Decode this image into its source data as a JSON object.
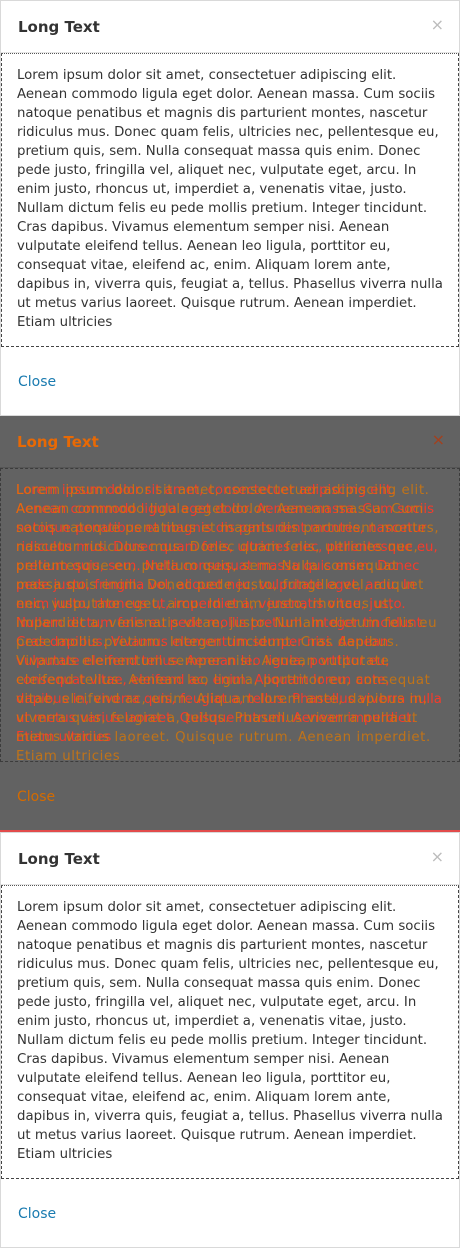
{
  "modal_top": {
    "title": "Long Text",
    "close_icon": "×",
    "body": "Lorem ipsum dolor sit amet, consectetuer adipiscing elit. Aenean commodo ligula eget dolor. Aenean massa. Cum sociis natoque penatibus et magnis dis parturient montes, nascetur ridiculus mus. Donec quam felis, ultricies nec, pellentesque eu, pretium quis, sem. Nulla consequat massa quis enim. Donec pede justo, fringilla vel, aliquet nec, vulputate eget, arcu. In enim justo, rhoncus ut, imperdiet a, venenatis vitae, justo. Nullam dictum felis eu pede mollis pretium. Integer tincidunt. Cras dapibus. Vivamus elementum semper nisi. Aenean vulputate eleifend tellus. Aenean leo ligula, porttitor eu, consequat vitae, eleifend ac, enim. Aliquam lorem ante, dapibus in, viverra quis, feugiat a, tellus. Phasellus viverra nulla ut metus varius laoreet. Quisque rutrum. Aenean imperdiet. Etiam ultricies",
    "close_label": "Close"
  },
  "modal_middle": {
    "title": "Long Text",
    "close_icon": "×",
    "body": "Lorem ipsum dolor sit amet, consectetuer adipiscing elit. Aenean commodo ligula eget dolor. Aenean massa. Cum sociis natoque penatibus et magnis dis parturient montes, nascetur ridiculus mus. Donec quam felis, ultricies nec, pellentesque eu, pretium quis, sem. Nulla consequat massa quis enim. Donec pede justo, fringilla vel, aliquet nec, vulputate eget, arcu. In enim justo, rhoncus ut, imperdiet a, venenatis vitae, justo. Nullam dictum felis eu pede mollis pretium. Integer tincidunt. Cras dapibus. Vivamus elementum semper nisi. Aenean vulputate eleifend tellus. Aenean leo ligula, porttitor eu, consequat vitae, eleifend ac, enim. Aliquam lorem ante, dapibus in, viverra quis, feugiat a, tellus. Phasellus viverra nulla ut metus varius laoreet. Quisque rutrum. Aenean imperdiet. Etiam ultricies",
    "close_label": "Close"
  },
  "modal_bottom": {
    "title": "Long Text",
    "close_icon": "×",
    "body": "Lorem ipsum dolor sit amet, consectetuer adipiscing elit. Aenean commodo ligula eget dolor. Aenean massa. Cum sociis natoque penatibus et magnis dis parturient montes, nascetur ridiculus mus. Donec quam felis, ultricies nec, pellentesque eu, pretium quis, sem. Nulla consequat massa quis enim. Donec pede justo, fringilla vel, aliquet nec, vulputate eget, arcu. In enim justo, rhoncus ut, imperdiet a, venenatis vitae, justo. Nullam dictum felis eu pede mollis pretium. Integer tincidunt. Cras dapibus. Vivamus elementum semper nisi. Aenean vulputate eleifend tellus. Aenean leo ligula, porttitor eu, consequat vitae, eleifend ac, enim. Aliquam lorem ante, dapibus in, viverra quis, feugiat a, tellus. Phasellus viverra nulla ut metus varius laoreet. Quisque rutrum. Aenean imperdiet. Etiam ultricies",
    "close_label": "Close"
  },
  "colors": {
    "overlay": "#626262",
    "link": "#1a7bb0",
    "overlay_text_red": "#f53c2b",
    "overlay_text_orange": "#e07900"
  }
}
